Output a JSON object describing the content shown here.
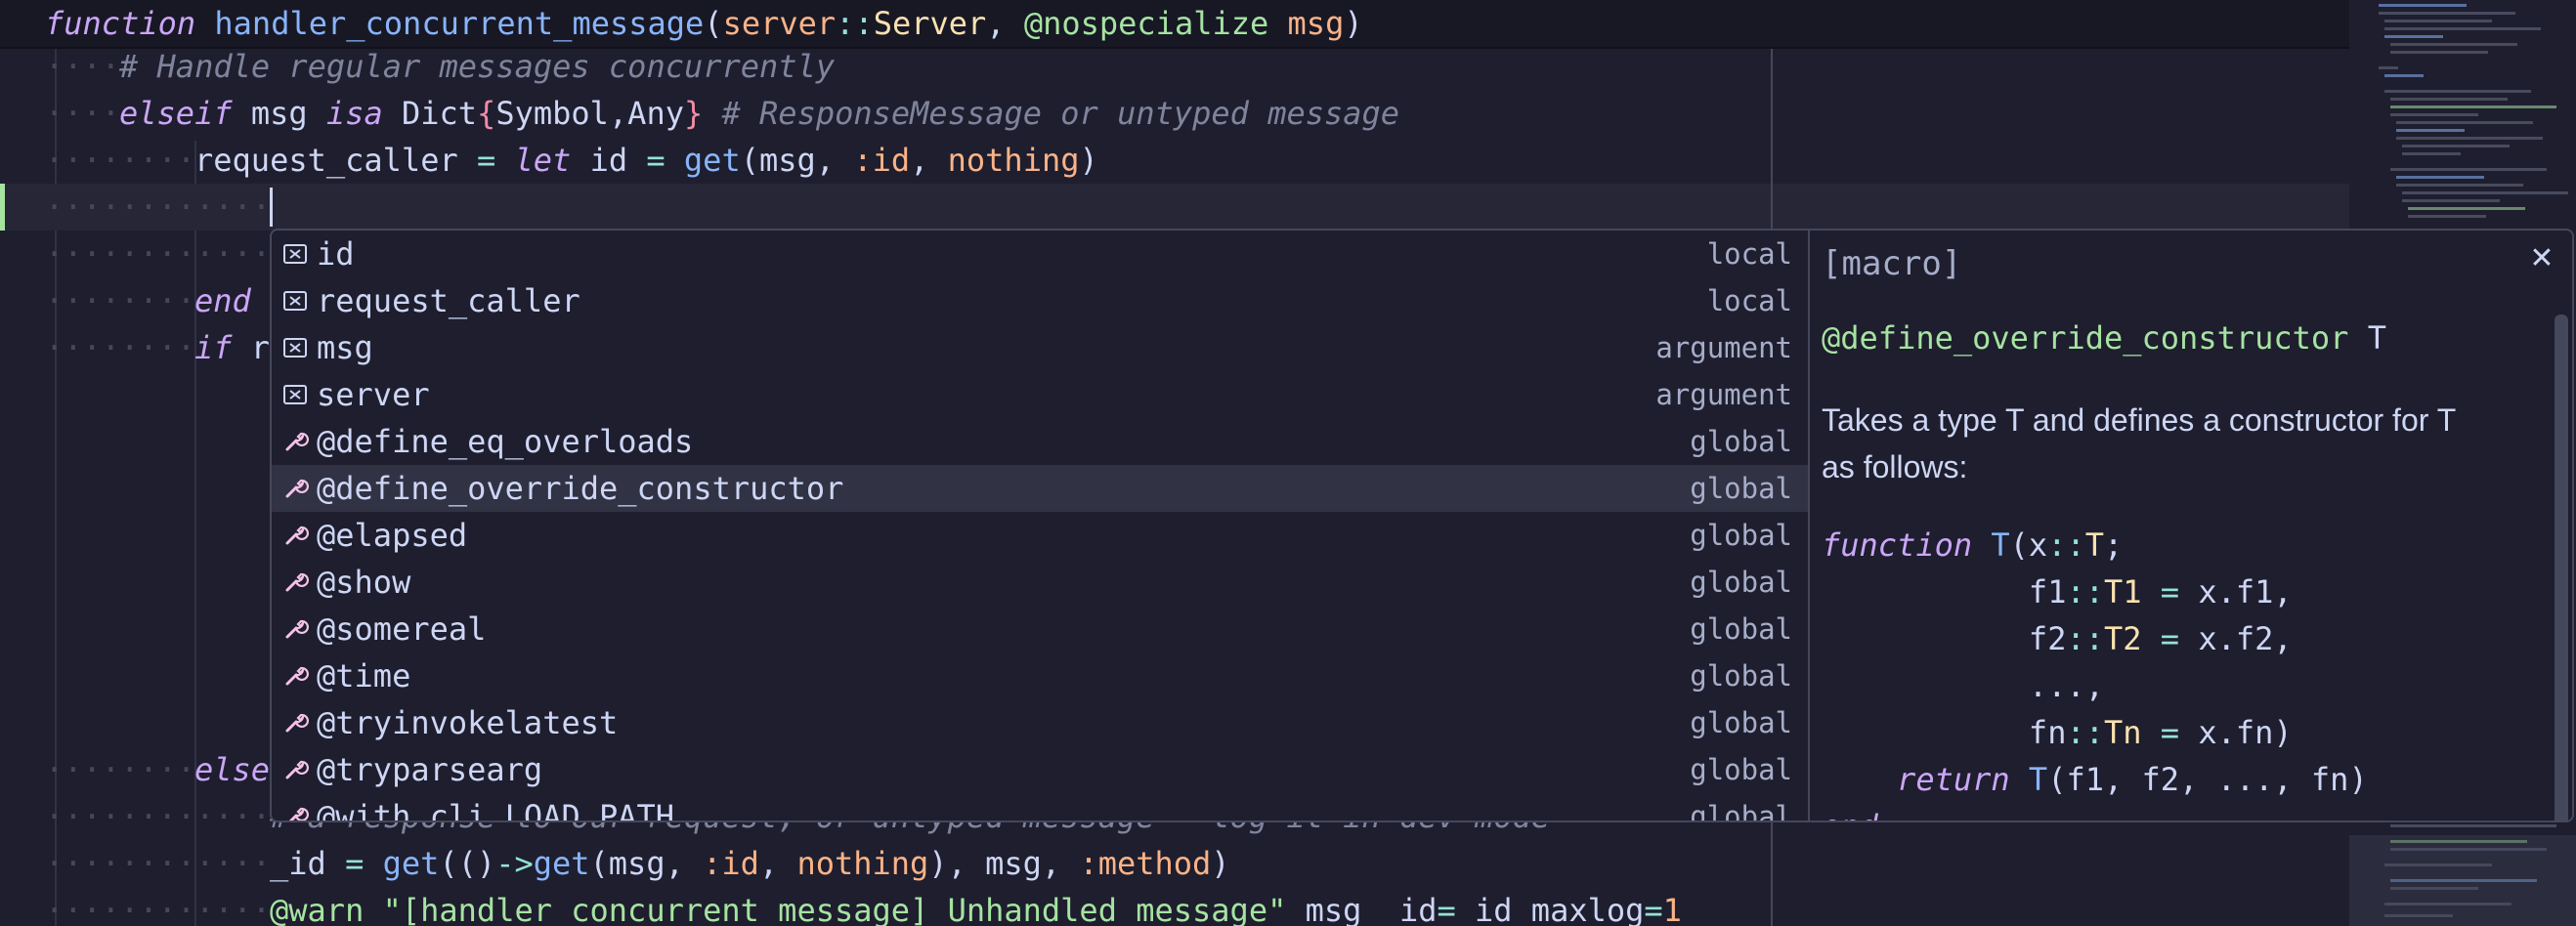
{
  "editor": {
    "sticky": {
      "kw": "function",
      "fname": "handler_concurrent_message",
      "open": "(",
      "p1": "server",
      "p1sep": "::",
      "p1type": "Server",
      "comma": ", ",
      "macro": "@nospecialize",
      "p2": " msg",
      "close": ")"
    },
    "lines": {
      "l1": {
        "dots": "····",
        "comment": "# Handle regular messages concurrently"
      },
      "l2": {
        "dots": "····",
        "kw": "elseif",
        "a": " msg ",
        "isa": "isa",
        "b": " Dict",
        "c1": "{",
        "d": "Symbol,Any",
        "c2": "}",
        "comment": " # ResponseMessage or untyped message"
      },
      "l3": {
        "dots": "········",
        "a": "request_caller ",
        "eq": "=",
        "b": " ",
        "let": "let",
        "c": " id ",
        "eq2": "=",
        "d": " ",
        "fn": "get",
        "e": "(msg, ",
        "sym": ":id",
        "f": ", ",
        "nothing": "nothing",
        "g": ")"
      },
      "l4": {
        "dots": "············"
      },
      "l5": {
        "dots": "············"
      },
      "l6": {
        "dots": "········",
        "kw": "end"
      },
      "l7": {
        "dots": "········",
        "kw": "if",
        "rest": " r"
      },
      "l15": {
        "dots": "········",
        "kw": "else"
      },
      "l16": {
        "dots": "············",
        "comment": "# a response to our request, or untyped message - log it in dev mode"
      },
      "l17": {
        "dots": "············",
        "a": "_id ",
        "eq": "=",
        "b": " ",
        "fn": "get",
        "c": "(()",
        "arrow": "->",
        "fn2": "get",
        "d": "(msg, ",
        "sym": ":id",
        "e": ", ",
        "nothing": "nothing",
        "f": "), msg, ",
        "sym2": ":method",
        "g": ")"
      },
      "l18": {
        "dots": "············",
        "macro": "@warn",
        "sp": " ",
        "str": "\"[handler_concurrent_message] Unhandled message\"",
        "a": " msg _id",
        "eq": "=",
        "b": "_id maxlog",
        "eq2": "=",
        "num": "1"
      }
    }
  },
  "suggest": {
    "items": [
      {
        "label": "id",
        "kind": "local",
        "icon": "variable-icon"
      },
      {
        "label": "request_caller",
        "kind": "local",
        "icon": "variable-icon"
      },
      {
        "label": "msg",
        "kind": "argument",
        "icon": "variable-icon"
      },
      {
        "label": "server",
        "kind": "argument",
        "icon": "variable-icon"
      },
      {
        "label": "@define_eq_overloads",
        "kind": "global",
        "icon": "wrench-icon"
      },
      {
        "label": "@define_override_constructor",
        "kind": "global",
        "icon": "wrench-icon",
        "selected": true
      },
      {
        "label": "@elapsed",
        "kind": "global",
        "icon": "wrench-icon"
      },
      {
        "label": "@show",
        "kind": "global",
        "icon": "wrench-icon"
      },
      {
        "label": "@somereal",
        "kind": "global",
        "icon": "wrench-icon"
      },
      {
        "label": "@time",
        "kind": "global",
        "icon": "wrench-icon"
      },
      {
        "label": "@tryinvokelatest",
        "kind": "global",
        "icon": "wrench-icon"
      },
      {
        "label": "@tryparsearg",
        "kind": "global",
        "icon": "wrench-icon"
      },
      {
        "label": "@with_cli_LOAD_PATH",
        "kind": "global",
        "icon": "wrench-icon"
      }
    ]
  },
  "details": {
    "tag": "[macro]",
    "sig_name": "@define_override_constructor",
    "sig_arg": " T",
    "desc1": "Takes a type  T  and defines a constructor for  T",
    "desc2": "as follows:",
    "code": {
      "c1": {
        "kw": "function",
        "sp": " ",
        "fn": "T",
        "a": "(x",
        "op": "::",
        "ty": "T",
        "b": ";"
      },
      "c2": {
        "ind": "           ",
        "a": "f1",
        "op": "::",
        "ty": "T1",
        "b": " ",
        "eq": "=",
        "c": " x.f1,"
      },
      "c3": {
        "ind": "           ",
        "a": "f2",
        "op": "::",
        "ty": "T2",
        "b": " ",
        "eq": "=",
        "c": " x.f2,"
      },
      "c4": {
        "ind": "           ",
        "a": "...,"
      },
      "c5": {
        "ind": "           ",
        "a": "fn",
        "op": "::",
        "ty": "Tn",
        "b": " ",
        "eq": "=",
        "c": " x.fn)"
      },
      "c6": {
        "ind": "    ",
        "kw": "return",
        "sp": " ",
        "fn": "T",
        "a": "(f1, f2, ..., fn)"
      },
      "c7": {
        "a": "end"
      }
    },
    "close_icon": "close-icon"
  },
  "colors": {
    "background": "#1e1e2e",
    "selection": "#313244",
    "keyword": "#cba6f7",
    "function": "#89b4fa",
    "type": "#f9e2af",
    "string": "#a6e3a1",
    "comment": "#7f849c",
    "modified_gutter": "#a6e3a1"
  }
}
